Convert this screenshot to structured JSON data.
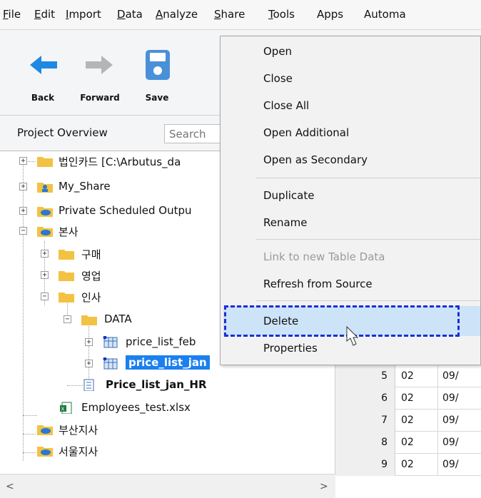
{
  "menubar": {
    "items": [
      {
        "label": "File",
        "mn": "F"
      },
      {
        "label": "Edit",
        "mn": "E"
      },
      {
        "label": "Import",
        "mn": "I"
      },
      {
        "label": "Data",
        "mn": "D"
      },
      {
        "label": "Analyze",
        "mn": "A"
      },
      {
        "label": "Share",
        "mn": "S"
      },
      {
        "label": "Tools",
        "mn": "T"
      },
      {
        "label": "Apps",
        "mn": ""
      },
      {
        "label": "Automa",
        "mn": ""
      }
    ]
  },
  "toolbar": {
    "back_label": "Back",
    "forward_label": "Forward",
    "save_label": "Save",
    "colors": {
      "back": "#1e88e5",
      "forward": "#b5b5b5",
      "save": "#4a90d9"
    }
  },
  "overview": {
    "title": "Project Overview",
    "search_placeholder": "Search"
  },
  "tree": {
    "nodes": [
      {
        "label": "법인카드 [C:\\Arbutus_da",
        "icon": "folder-icon"
      },
      {
        "label": "My_Share",
        "icon": "shared-folder-icon"
      },
      {
        "label": "Private Scheduled Outpu",
        "icon": "cloud-folder-icon"
      },
      {
        "label": "본사",
        "icon": "cloud-folder-icon"
      },
      {
        "label": "구매",
        "icon": "folder-icon"
      },
      {
        "label": "영업",
        "icon": "folder-icon"
      },
      {
        "label": "인사",
        "icon": "folder-icon"
      },
      {
        "label": "DATA",
        "icon": "folder-icon"
      },
      {
        "label": "price_list_feb",
        "icon": "table-icon"
      },
      {
        "label": "price_list_jan",
        "icon": "table-icon"
      },
      {
        "label": "Price_list_jan_HR",
        "icon": "document-icon"
      },
      {
        "label": "Employees_test.xlsx",
        "icon": "excel-file-icon"
      },
      {
        "label": "부산지사",
        "icon": "cloud-folder-icon"
      },
      {
        "label": "서울지사",
        "icon": "cloud-folder-icon"
      }
    ]
  },
  "grid": {
    "rows": [
      {
        "num": "5",
        "c1": "02",
        "c2": "09/"
      },
      {
        "num": "6",
        "c1": "02",
        "c2": "09/"
      },
      {
        "num": "7",
        "c1": "02",
        "c2": "09/"
      },
      {
        "num": "8",
        "c1": "02",
        "c2": "09/"
      },
      {
        "num": "9",
        "c1": "02",
        "c2": "09/"
      }
    ]
  },
  "context_menu": {
    "items": [
      {
        "label": "Open"
      },
      {
        "label": "Close"
      },
      {
        "label": "Close All"
      },
      {
        "label": "Open Additional"
      },
      {
        "label": "Open as Secondary"
      },
      {
        "label": "Duplicate"
      },
      {
        "label": "Rename"
      },
      {
        "label": "Link to new Table Data",
        "disabled": true
      },
      {
        "label": "Refresh from Source"
      },
      {
        "label": "Delete",
        "highlighted": true
      },
      {
        "label": "Properties"
      }
    ]
  }
}
